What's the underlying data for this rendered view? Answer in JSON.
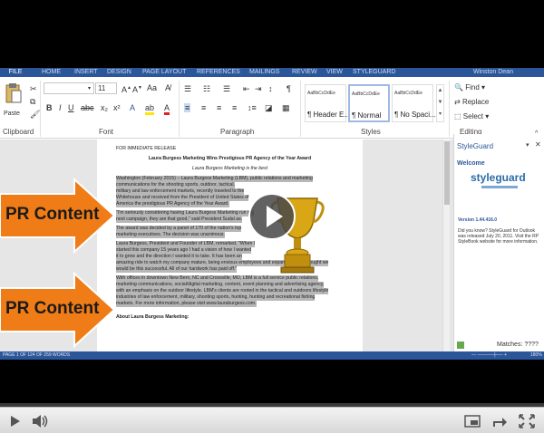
{
  "ribbon_tabs": [
    "FILE",
    "HOME",
    "INSERT",
    "DESIGN",
    "PAGE LAYOUT",
    "REFERENCES",
    "MAILINGS",
    "REVIEW",
    "VIEW",
    "STYLEGUARD"
  ],
  "user_name": "Winston Dean",
  "clipboard": {
    "paste_label": "Paste",
    "group_label": "Clipboard"
  },
  "font": {
    "size_value": "11",
    "group_label": "Font"
  },
  "paragraph": {
    "group_label": "Paragraph"
  },
  "styles": {
    "tiles": [
      {
        "sample": "AaBbCcDdEe",
        "name": "¶ Header E..."
      },
      {
        "sample": "AaBbCcDdEe",
        "name": "¶ Normal"
      },
      {
        "sample": "AaBbCcDdEe",
        "name": "¶ No Spaci..."
      }
    ],
    "group_label": "Styles"
  },
  "editing": {
    "find": "Find",
    "replace": "Replace",
    "select": "Select",
    "group_label": "Editing"
  },
  "document": {
    "release_tag": "FOR IMMEDIATE RELEASE",
    "headline": "Laura Burgess Marketing Wins Prestigious PR Agency of the Year Award",
    "subhead": "Laura Burgess Marketing is the best",
    "lines": [
      "Washington (February 2015) – Laura Burgess Marketing (LBM), public relations and marketing",
      "communications for the shooting sports, outdoor, tactical,",
      "military and law enforcement markets, recently traveled to the",
      "Whitehouse and received from the President of United States of",
      "America the prestigious PR Agency of the Year Award.",
      "\"I'm seriously considering having Laura Burgess Marketing run my",
      "next campaign, they are that good,\" said President Sudal as.",
      "The award was decided by a panel of 170 of the nation's top",
      "marketing executives. The decision was unanimous.",
      "Laura Burgess, President and Founder of LBM, remarked, \"When I",
      "started this company 15 years ago I had a vision of how I wanted",
      "it to grow and the direction I wanted it to take. It has been an",
      "amazing ride to watch my company mature, being envious employees and expand. I never thought we",
      "would be this successful. All of our hardwork has paid off.\"",
      "With offices in downtown New Bern, NC and Crossville, MO, LBM is a full service public relations,",
      "marketing communications, social/digital marketing, content, event planning and advertising agency,",
      "with an emphasis on the outdoor lifestyle. LBM's clients are rooted in the tactical and outdoors lifestyle",
      "industries of law enforcement, military, shooting sports, hunting, hunting and recreational fishing",
      "markets. For more information, please visit www.lauraburgess.com.",
      "About Laura Burgess Marketing:"
    ]
  },
  "overlay": {
    "pr_label_1": "PR Content",
    "pr_label_2": "PR Content"
  },
  "pane": {
    "title": "StyleGuard",
    "welcome": "Welcome",
    "logo_main": "styleguard",
    "version": "Version 1.44.416.0",
    "did_you_know": "Did you know? StyleGuard for Outlook was released July 20, 2011. Visit the RP StyleBook website for more information.",
    "matches": "Matches: ????"
  },
  "status": {
    "page": "PAGE 1 OF 1",
    "words": "24 OF 259 WORDS",
    "zoom": "180%"
  },
  "player": {
    "progress": 0.0
  },
  "colors": {
    "word_blue": "#2b579a",
    "arrow_orange": "#f07c17",
    "progress_red": "#cc181e",
    "trophy_gold": "#d9a615"
  }
}
